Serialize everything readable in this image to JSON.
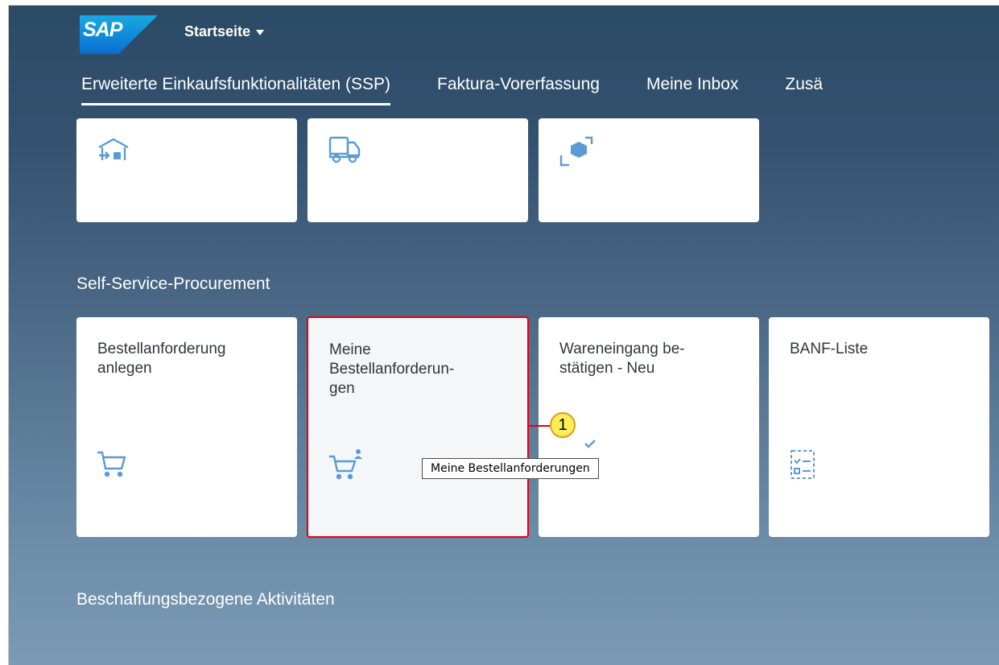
{
  "shell": {
    "logo_text": "SAP",
    "home_title": "Startseite"
  },
  "tabs": [
    {
      "label": "Erweiterte Einkaufsfunktionalitäten (SSP)"
    },
    {
      "label": "Faktura-Vorerfassung"
    },
    {
      "label": "Meine Inbox"
    },
    {
      "label": "Zusä"
    }
  ],
  "top_tiles": [
    {
      "icon": "warehouse-inbound-icon"
    },
    {
      "icon": "shipping-truck-icon"
    },
    {
      "icon": "transfer-cubes-icon"
    }
  ],
  "sections": [
    {
      "title": "Self-Service-Procurement",
      "tiles": [
        {
          "title": "Bestellanforderung\nanlegen",
          "icon": "cart-icon"
        },
        {
          "title": "Meine\nBestellanforderun-\ngen",
          "icon": "cart-user-icon"
        },
        {
          "title": "Wareneingang be-\nstätigen - Neu",
          "icon": "checkmark-icon"
        },
        {
          "title": "BANF-Liste",
          "icon": "checklist-icon"
        }
      ]
    },
    {
      "title": "Beschaffungsbezogene Aktivitäten"
    }
  ],
  "annotation": {
    "marker": "1",
    "tooltip": "Meine Bestellanforderungen",
    "highlight_color": "#e2001a",
    "marker_color": "#ffee58"
  },
  "colors": {
    "accent": "#0a6ed1",
    "icon": "#5b9bd5"
  }
}
